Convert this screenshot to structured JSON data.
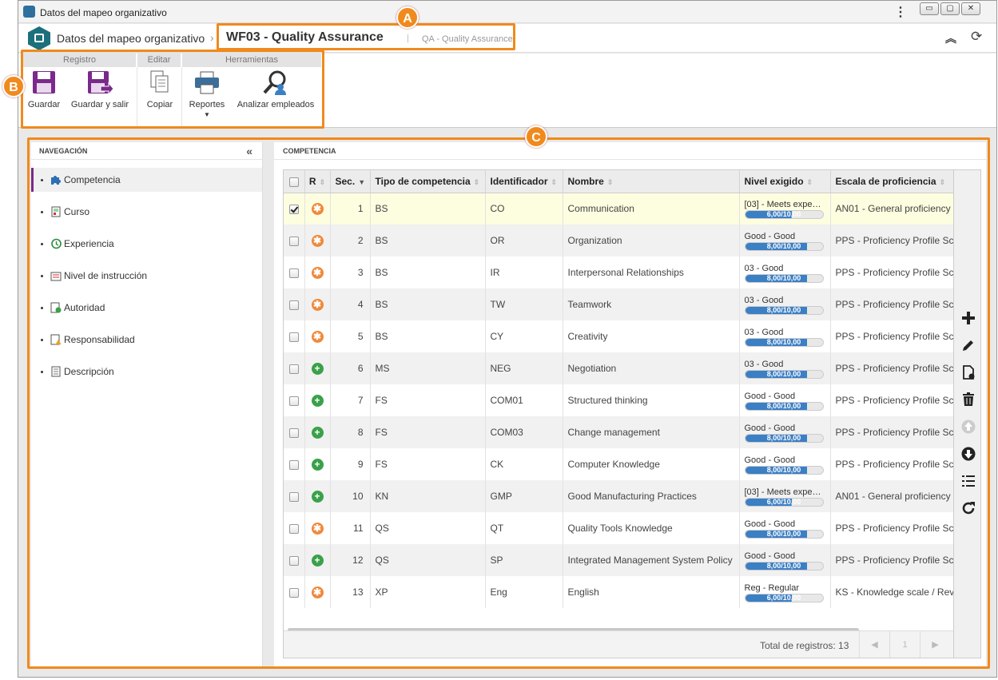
{
  "window": {
    "title": "Datos del mapeo organizativo",
    "menu_glyph": "⋮",
    "min": "▭",
    "max": "▢",
    "close": "✕"
  },
  "header": {
    "breadcrumb_root": "Datos del mapeo organizativo",
    "separator": "›",
    "title": "WF03 - Quality Assurance",
    "divider": "|",
    "subtitle": "QA - Quality Assurance"
  },
  "ribbon": {
    "groups": [
      "Registro",
      "Editar",
      "Herramientas"
    ],
    "buttons": {
      "save": "Guardar",
      "save_exit": "Guardar y salir",
      "copy": "Copiar",
      "reports": "Reportes",
      "analyze": "Analizar empleados"
    }
  },
  "annotations": {
    "a": "A",
    "b": "B",
    "c": "C"
  },
  "nav": {
    "header": "NAVEGACIÓN",
    "collapse": "«",
    "items": [
      {
        "label": "Competencia",
        "icon": "puzzle-icon"
      },
      {
        "label": "Curso",
        "icon": "course-icon"
      },
      {
        "label": "Experiencia",
        "icon": "history-icon"
      },
      {
        "label": "Nivel de instrucción",
        "icon": "education-icon"
      },
      {
        "label": "Autoridad",
        "icon": "authority-icon"
      },
      {
        "label": "Responsabilidad",
        "icon": "responsibility-icon"
      },
      {
        "label": "Descripción",
        "icon": "description-icon"
      }
    ]
  },
  "main": {
    "header": "COMPETENCIA",
    "columns": {
      "r": "R",
      "seq": "Sec.",
      "type": "Tipo de competencia",
      "id": "Identificador",
      "name": "Nombre",
      "level": "Nivel exigido",
      "scale": "Escala de proficiencia"
    },
    "rows": [
      {
        "checked": true,
        "r": "o",
        "seq": "1",
        "type": "BS",
        "id": "CO",
        "name": "Communication",
        "level": "[03] - Meets expe…",
        "bar": "6,00/10,00",
        "pct": 60,
        "scale": "AN01 - General proficiency r"
      },
      {
        "checked": false,
        "r": "o",
        "seq": "2",
        "type": "BS",
        "id": "OR",
        "name": "Organization",
        "level": "Good - Good",
        "bar": "8,00/10,00",
        "pct": 80,
        "scale": "PPS - Proficiency Profile Sc"
      },
      {
        "checked": false,
        "r": "o",
        "seq": "3",
        "type": "BS",
        "id": "IR",
        "name": "Interpersonal Relationships",
        "level": "03 - Good",
        "bar": "8,00/10,00",
        "pct": 80,
        "scale": "PPS - Proficiency Profile Sc"
      },
      {
        "checked": false,
        "r": "o",
        "seq": "4",
        "type": "BS",
        "id": "TW",
        "name": "Teamwork",
        "level": "03 - Good",
        "bar": "8,00/10,00",
        "pct": 80,
        "scale": "PPS - Proficiency Profile Sc"
      },
      {
        "checked": false,
        "r": "o",
        "seq": "5",
        "type": "BS",
        "id": "CY",
        "name": "Creativity",
        "level": "03 - Good",
        "bar": "8,00/10,00",
        "pct": 80,
        "scale": "PPS - Proficiency Profile Sc"
      },
      {
        "checked": false,
        "r": "g",
        "seq": "6",
        "type": "MS",
        "id": "NEG",
        "name": "Negotiation",
        "level": "03 - Good",
        "bar": "8,00/10,00",
        "pct": 80,
        "scale": "PPS - Proficiency Profile Sc"
      },
      {
        "checked": false,
        "r": "g",
        "seq": "7",
        "type": "FS",
        "id": "COM01",
        "name": "Structured thinking",
        "level": "Good - Good",
        "bar": "8,00/10,00",
        "pct": 80,
        "scale": "PPS - Proficiency Profile Sc"
      },
      {
        "checked": false,
        "r": "g",
        "seq": "8",
        "type": "FS",
        "id": "COM03",
        "name": "Change management",
        "level": "Good - Good",
        "bar": "8,00/10,00",
        "pct": 80,
        "scale": "PPS - Proficiency Profile Sc"
      },
      {
        "checked": false,
        "r": "g",
        "seq": "9",
        "type": "FS",
        "id": "CK",
        "name": "Computer Knowledge",
        "level": "Good - Good",
        "bar": "8,00/10,00",
        "pct": 80,
        "scale": "PPS - Proficiency Profile Sc"
      },
      {
        "checked": false,
        "r": "g",
        "seq": "10",
        "type": "KN",
        "id": "GMP",
        "name": "Good Manufacturing Practices",
        "level": "[03] - Meets expe…",
        "bar": "6,00/10,00",
        "pct": 60,
        "scale": "AN01 - General proficiency r"
      },
      {
        "checked": false,
        "r": "o",
        "seq": "11",
        "type": "QS",
        "id": "QT",
        "name": "Quality Tools Knowledge",
        "level": "Good - Good",
        "bar": "8,00/10,00",
        "pct": 80,
        "scale": "PPS - Proficiency Profile Sc"
      },
      {
        "checked": false,
        "r": "g",
        "seq": "12",
        "type": "QS",
        "id": "SP",
        "name": "Integrated Management System Policy",
        "level": "Good - Good",
        "bar": "8,00/10,00",
        "pct": 80,
        "scale": "PPS - Proficiency Profile Sc"
      },
      {
        "checked": false,
        "r": "o",
        "seq": "13",
        "type": "XP",
        "id": "Eng",
        "name": "English",
        "level": "Reg - Regular",
        "bar": "6,00/10,00",
        "pct": 60,
        "scale": "KS - Knowledge scale / Rev"
      }
    ],
    "total": "Total de registros: 13",
    "pager": {
      "prev": "◀",
      "page": "1",
      "next": "▶"
    }
  },
  "tools": [
    "add-icon",
    "edit-icon",
    "details-icon",
    "delete-icon",
    "move-up-icon",
    "move-down-icon",
    "list-icon",
    "refresh-icon"
  ],
  "colors": {
    "accent": "#f08a1c",
    "bar": "#3b7fc4",
    "purple": "#7a2a8a",
    "green": "#3aa14a",
    "orange_dot": "#f0883a"
  }
}
